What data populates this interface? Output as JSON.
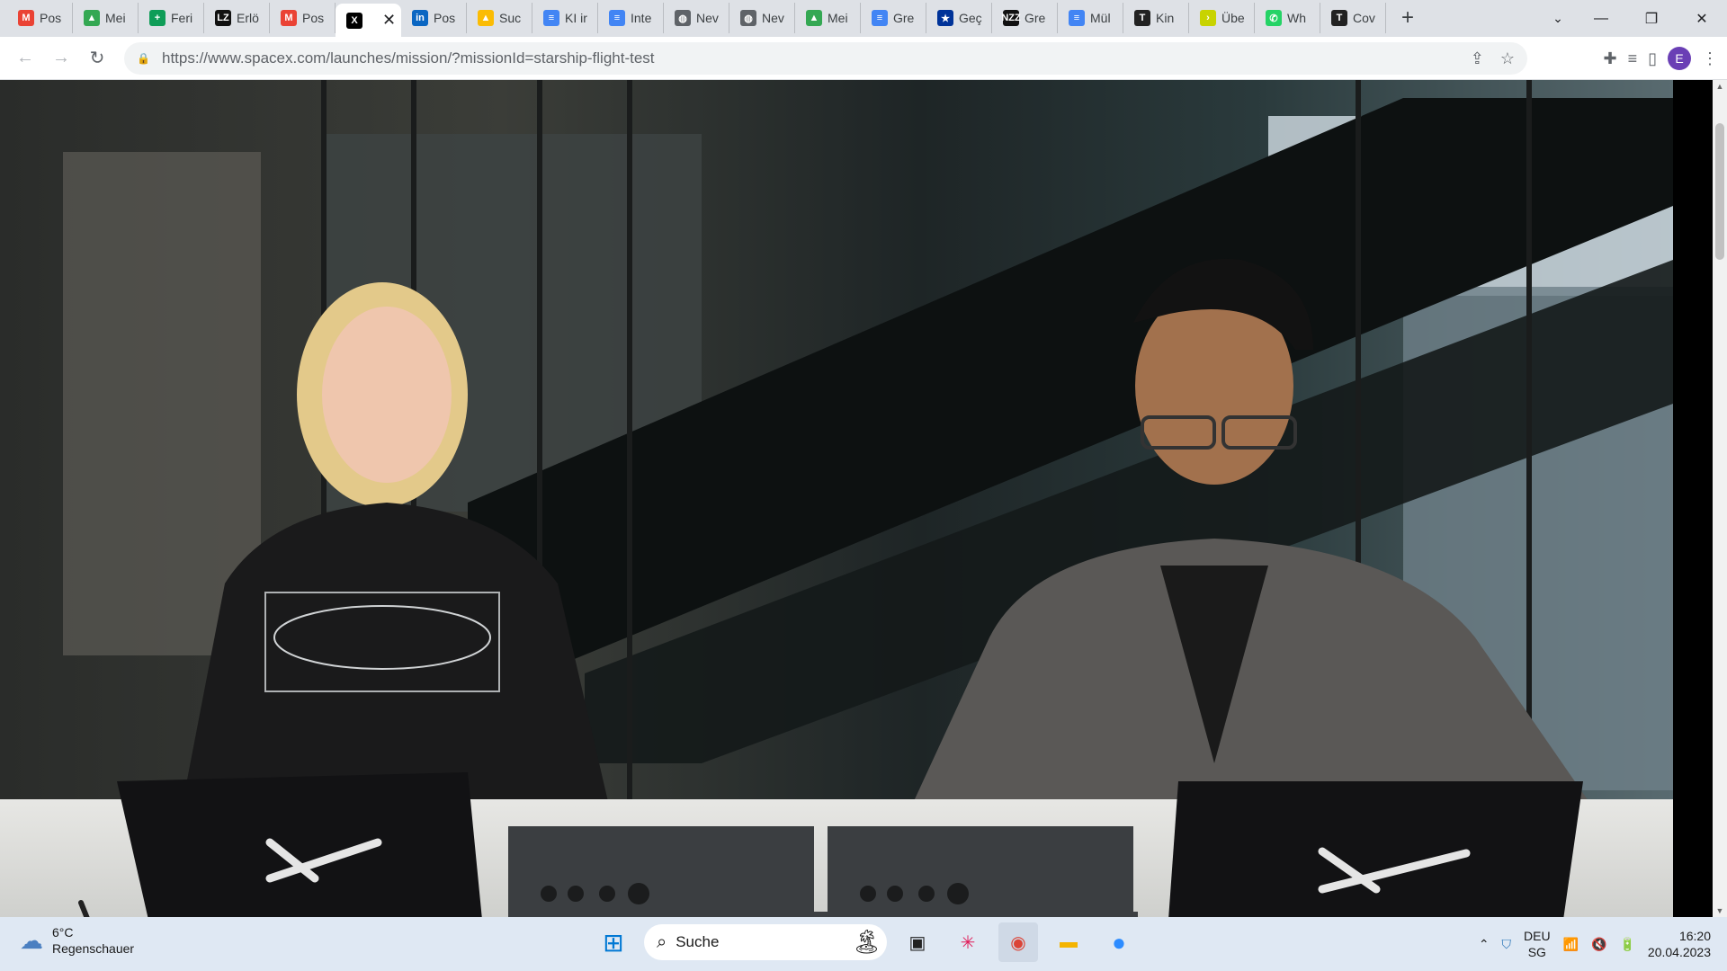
{
  "colors": {
    "tabstrip_bg": "#dee1e6",
    "taskbar_bg": "#dfe8f3",
    "avatar_bg": "#6a3fb5"
  },
  "tabs": [
    {
      "title": "Pos",
      "icon": "gmail-icon",
      "color": "#ea4335",
      "glyph": "M"
    },
    {
      "title": "Mei",
      "icon": "google-drive-icon",
      "color": "#34a853",
      "glyph": "▲"
    },
    {
      "title": "Feri",
      "icon": "google-sheets-icon",
      "color": "#0f9d58",
      "glyph": "+"
    },
    {
      "title": "Erlö",
      "icon": "lz-icon",
      "color": "#111111",
      "glyph": "LZ"
    },
    {
      "title": "Pos",
      "icon": "gmail-icon",
      "color": "#ea4335",
      "glyph": "M"
    },
    {
      "title": "",
      "icon": "spacex-icon",
      "color": "#000000",
      "glyph": "X",
      "active": true
    },
    {
      "title": "Pos",
      "icon": "linkedin-icon",
      "color": "#0a66c2",
      "glyph": "in"
    },
    {
      "title": "Suc",
      "icon": "google-drive-icon",
      "color": "#fbbc04",
      "glyph": "▲"
    },
    {
      "title": "KI ir",
      "icon": "google-docs-icon",
      "color": "#4285f4",
      "glyph": "≡"
    },
    {
      "title": "Inte",
      "icon": "google-docs-icon",
      "color": "#4285f4",
      "glyph": "≡"
    },
    {
      "title": "Nev",
      "icon": "globe-icon",
      "color": "#5f6368",
      "glyph": "◍"
    },
    {
      "title": "Nev",
      "icon": "globe-icon",
      "color": "#5f6368",
      "glyph": "◍"
    },
    {
      "title": "Mei",
      "icon": "google-drive-icon",
      "color": "#34a853",
      "glyph": "▲"
    },
    {
      "title": "Gre",
      "icon": "google-docs-icon",
      "color": "#4285f4",
      "glyph": "≡"
    },
    {
      "title": "Geç",
      "icon": "eu-flag-icon",
      "color": "#003399",
      "glyph": "★"
    },
    {
      "title": "Gre",
      "icon": "nzz-icon",
      "color": "#111111",
      "glyph": "NZZ"
    },
    {
      "title": "Mül",
      "icon": "google-docs-icon",
      "color": "#4285f4",
      "glyph": "≡"
    },
    {
      "title": "Kin",
      "icon": "nyt-icon",
      "color": "#222222",
      "glyph": "T"
    },
    {
      "title": "Übe",
      "icon": "chevron-icon",
      "color": "#c8d300",
      "glyph": "›"
    },
    {
      "title": "Wh",
      "icon": "whatsapp-icon",
      "color": "#25d366",
      "glyph": "✆"
    },
    {
      "title": "Cov",
      "icon": "nyt-icon",
      "color": "#222222",
      "glyph": "T"
    }
  ],
  "address_bar": {
    "url": "https://www.spacex.com/launches/mission/?missionId=starship-flight-test"
  },
  "profile": {
    "initial": "E"
  },
  "taskbar": {
    "weather": {
      "temp": "6°C",
      "condition": "Regenschauer"
    },
    "search_placeholder": "Suche",
    "language": {
      "top": "DEU",
      "bottom": "SG"
    },
    "time": "16:20",
    "date": "20.04.2023"
  }
}
